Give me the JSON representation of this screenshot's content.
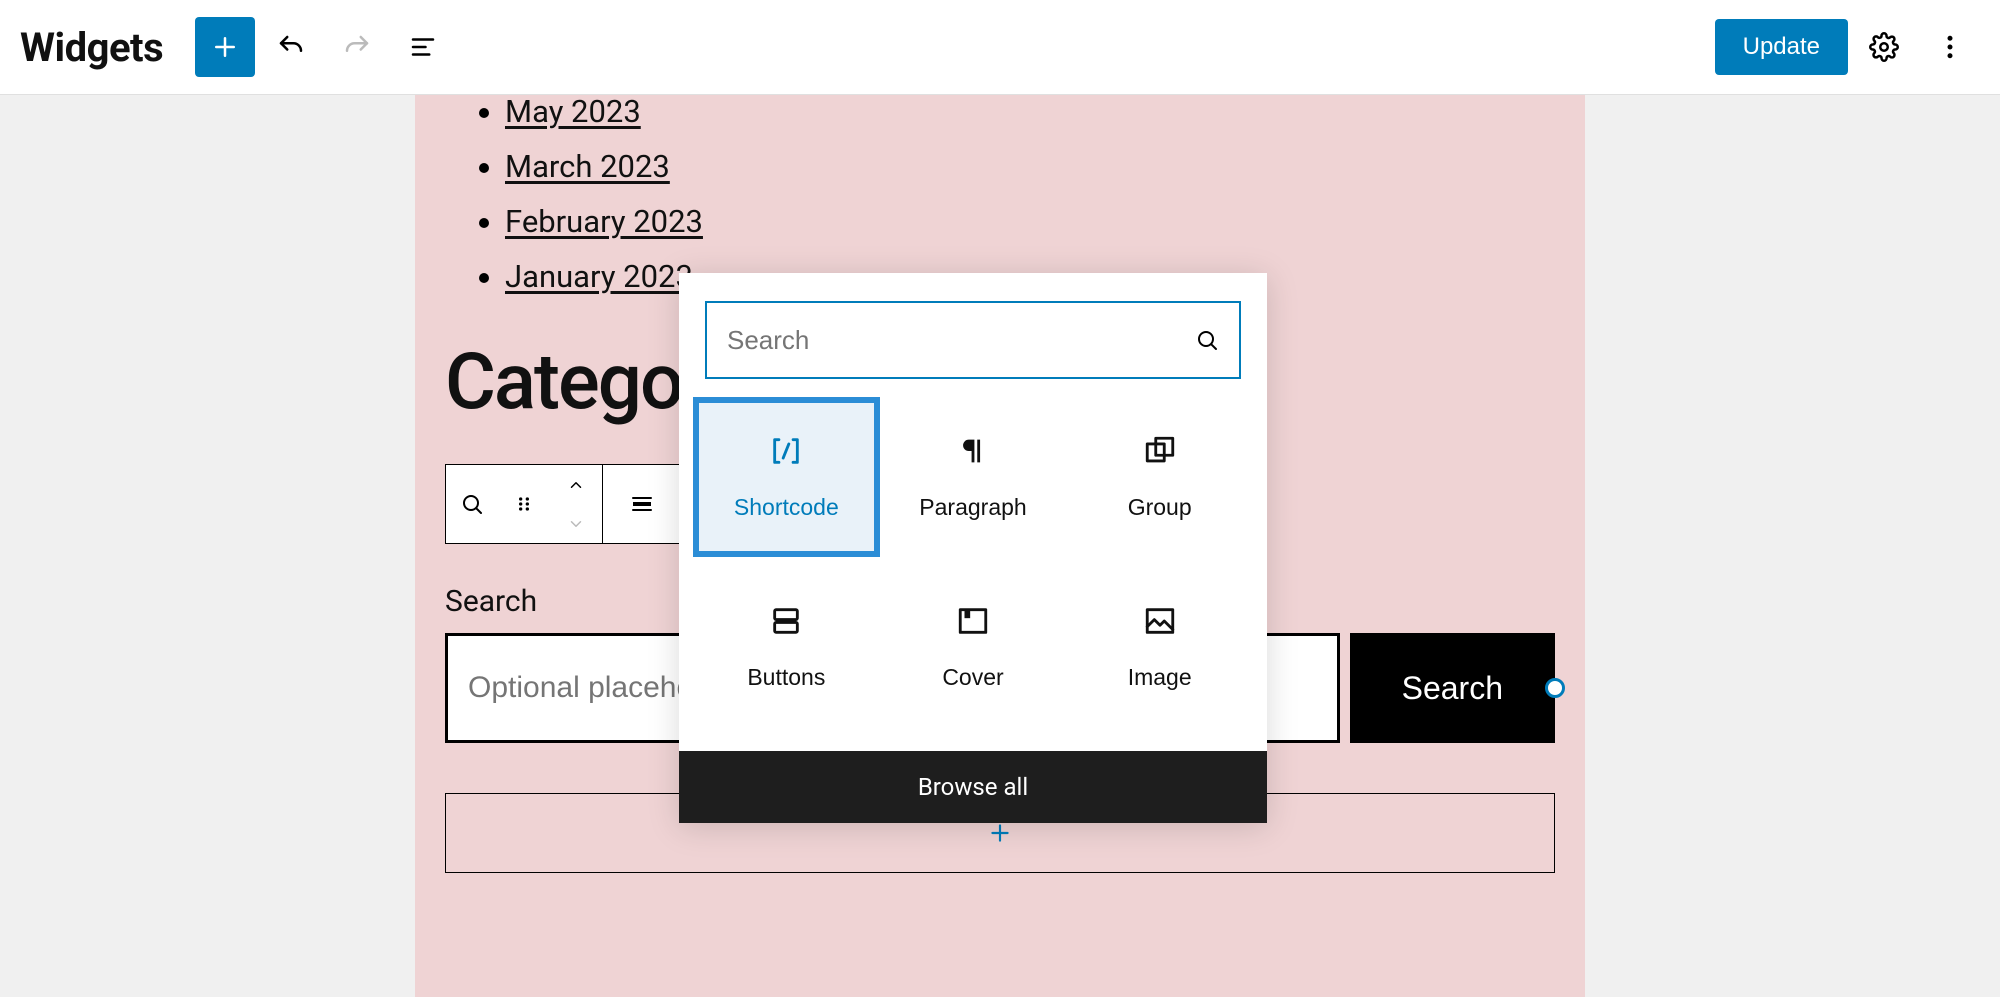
{
  "header": {
    "title": "Widgets",
    "update_label": "Update"
  },
  "archives": {
    "items": [
      "May 2023",
      "March 2023",
      "February 2023",
      "January 2023"
    ]
  },
  "categories_heading": "Categories",
  "search_block": {
    "label": "Search",
    "placeholder": "Optional placeholder…",
    "button_label": "Search"
  },
  "inserter": {
    "search_placeholder": "Search",
    "browse_all_label": "Browse all",
    "items": [
      {
        "id": "shortcode",
        "label": "Shortcode",
        "icon": "shortcode",
        "selected": true
      },
      {
        "id": "paragraph",
        "label": "Paragraph",
        "icon": "paragraph",
        "selected": false
      },
      {
        "id": "group",
        "label": "Group",
        "icon": "group",
        "selected": false
      },
      {
        "id": "buttons",
        "label": "Buttons",
        "icon": "buttons",
        "selected": false
      },
      {
        "id": "cover",
        "label": "Cover",
        "icon": "cover",
        "selected": false
      },
      {
        "id": "image",
        "label": "Image",
        "icon": "image",
        "selected": false
      }
    ]
  }
}
